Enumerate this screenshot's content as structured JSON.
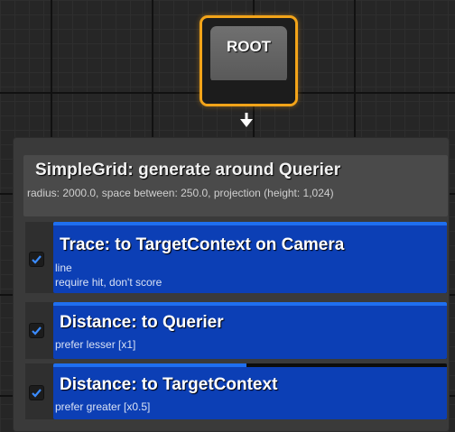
{
  "root_node": {
    "label": "ROOT"
  },
  "generator": {
    "title": "SimpleGrid: generate around Querier",
    "description": "radius: 2000.0, space between: 250.0, projection (height: 1,024)"
  },
  "tests": [
    {
      "title": "Trace: to TargetContext on Camera",
      "lines": [
        "line",
        "require hit, don't score"
      ],
      "enabled": true,
      "bar_fill_fraction": 1.0
    },
    {
      "title": "Distance: to Querier",
      "lines": [
        "prefer lesser [x1]"
      ],
      "enabled": true,
      "bar_fill_fraction": 1.0
    },
    {
      "title": "Distance: to TargetContext",
      "lines": [
        "prefer greater [x0.5]"
      ],
      "enabled": true,
      "bar_fill_fraction": 0.49
    }
  ],
  "colors": {
    "selection_outline": "#f3a419",
    "test_card": "#0c3fb5",
    "score_bar": "#1f6ff0",
    "checkmark": "#3b8cff"
  }
}
